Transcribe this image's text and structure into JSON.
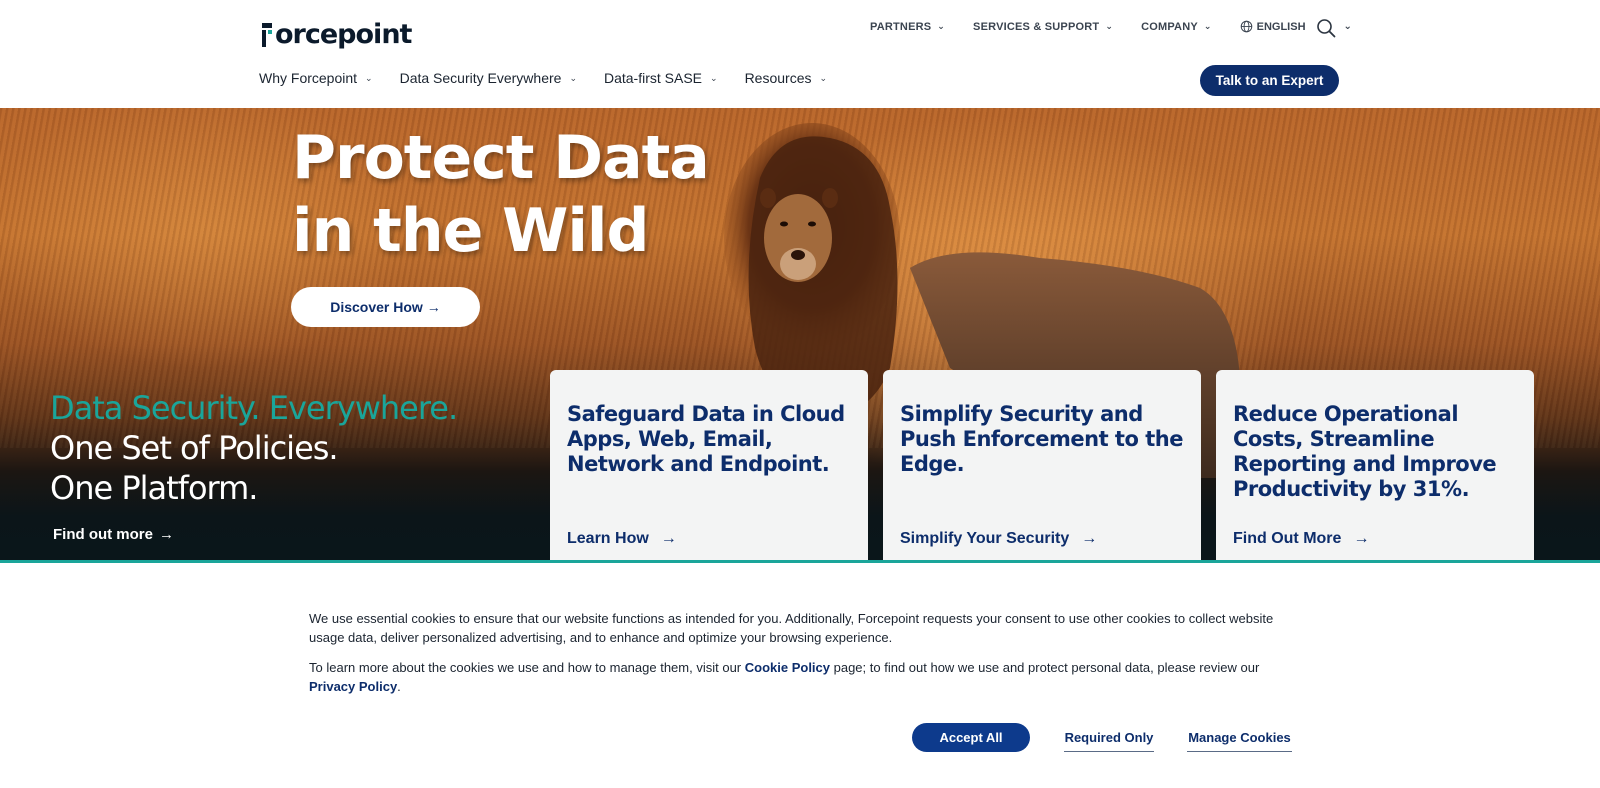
{
  "brand": {
    "logo_text": "orcepoint",
    "accent_color": "#1aa59a",
    "navy_color": "#0d2d6b"
  },
  "utility_nav": {
    "items": [
      {
        "label": "PARTNERS",
        "icon": "chevron-down-icon"
      },
      {
        "label": "SERVICES & SUPPORT",
        "icon": "chevron-down-icon"
      },
      {
        "label": "COMPANY",
        "icon": "chevron-down-icon"
      }
    ],
    "language": "ENGLISH",
    "language_icon": "globe-icon",
    "search_icon": "search-icon"
  },
  "main_nav": {
    "items": [
      {
        "label": "Why Forcepoint"
      },
      {
        "label": "Data Security Everywhere"
      },
      {
        "label": "Data-first SASE"
      },
      {
        "label": "Resources"
      }
    ],
    "cta_label": "Talk to an Expert"
  },
  "hero": {
    "title_line1": "Protect Data",
    "title_line2": "in the Wild",
    "button_label": "Discover How",
    "arrow": "→",
    "tagline_line1": "Data Security. Everywhere.",
    "tagline_line2": "One Set of Policies.",
    "tagline_line3": "One Platform.",
    "find_more_label": "Find out more"
  },
  "cards": [
    {
      "title": "Safeguard Data in Cloud Apps, Web, Email, Network and Endpoint.",
      "link": "Learn How"
    },
    {
      "title": "Simplify Security and Push Enforcement to the Edge.",
      "link": "Simplify Your Security"
    },
    {
      "title": "Reduce Operational Costs, Streamline Reporting and Improve Productivity by 31%.",
      "link": "Find Out More"
    }
  ],
  "cookie_banner": {
    "paragraph1": "We use essential cookies to ensure that our website functions as intended for you. Additionally, Forcepoint requests your consent to use other cookies to collect website usage data, deliver personalized advertising, and to enhance and optimize your browsing experience.",
    "paragraph2_before": "To learn more about the cookies we use and how to manage them, visit our ",
    "cookie_policy_link": "Cookie Policy",
    "paragraph2_middle": " page; to find out how we use and protect personal data, please review our ",
    "privacy_policy_link": "Privacy Policy",
    "paragraph2_end": ".",
    "accept_label": "Accept All",
    "required_label": "Required Only",
    "manage_label": "Manage Cookies"
  }
}
